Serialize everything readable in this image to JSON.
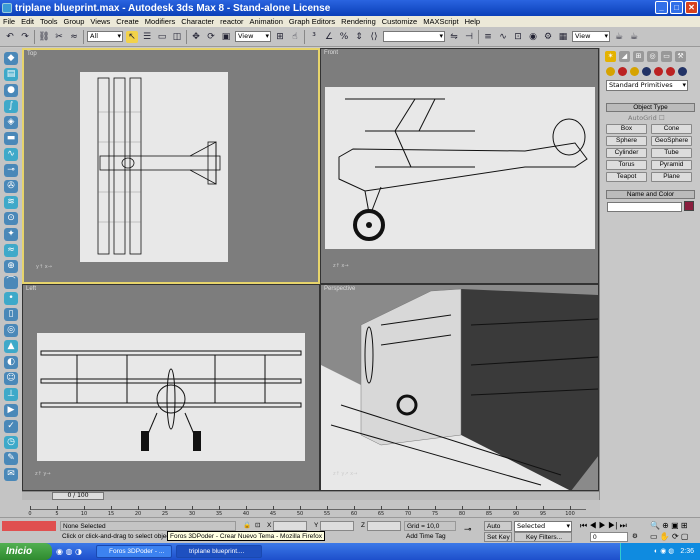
{
  "window": {
    "title": "triplane blueprint.max - Autodesk 3ds Max 8  - Stand-alone License"
  },
  "menu": [
    "File",
    "Edit",
    "Tools",
    "Group",
    "Views",
    "Create",
    "Modifiers",
    "Character",
    "reactor",
    "Animation",
    "Graph Editors",
    "Rendering",
    "Customize",
    "MAXScript",
    "Help"
  ],
  "toolbar": {
    "selection_filter": "All",
    "ref_coord": "View",
    "named_selection": "",
    "view_dropdown": "View"
  },
  "viewports": {
    "top": "Top",
    "front": "Front",
    "left": "Left",
    "perspective": "Perspective"
  },
  "command_panel": {
    "primitive_type": "Standard Primitives",
    "object_type_title": "Object Type",
    "autogrid": "AutoGrid",
    "objects": [
      "Box",
      "Cone",
      "Sphere",
      "GeoSphere",
      "Cylinder",
      "Tube",
      "Torus",
      "Pyramid",
      "Teapot",
      "Plane"
    ],
    "name_color_title": "Name and Color",
    "swatch_color": "#8a1e3e"
  },
  "timeline": {
    "frame": "0 / 100",
    "ticks": [
      "0",
      "5",
      "10",
      "15",
      "20",
      "25",
      "30",
      "35",
      "40",
      "45",
      "50",
      "55",
      "60",
      "65",
      "70",
      "75",
      "80",
      "85",
      "90",
      "95",
      "100"
    ]
  },
  "status": {
    "selection": "None Selected",
    "prompt": "Click or click-and-drag to select objects",
    "x_label": "X",
    "y_label": "Y",
    "z_label": "Z",
    "grid": "Grid = 10,0",
    "add_time_tag": "Add Time Tag",
    "auto_key": "Auto Key",
    "set_key": "Set Key",
    "selected_dropdown": "Selected",
    "key_filters": "Key Filters...",
    "frame_field": "0"
  },
  "tooltip": "Foros 3DPoder - Crear Nuevo Tema - Mozilla Firefox",
  "taskbar": {
    "start": "Inicio",
    "tasks": [
      "Foros 3DPoder - ...",
      "triplane blueprint...."
    ],
    "clock": "2:36"
  }
}
